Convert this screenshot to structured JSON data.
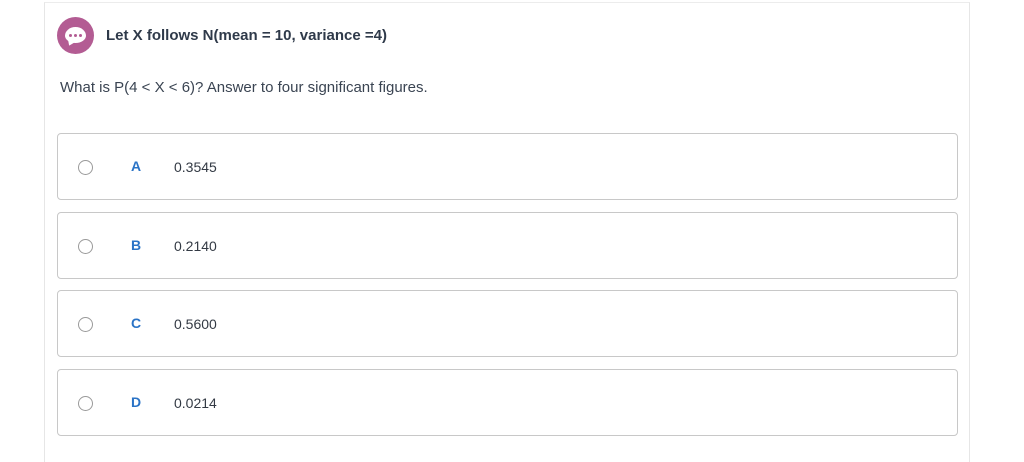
{
  "question": {
    "title": "Let X follows N(mean = 10, variance =4)",
    "prompt": "What is P(4 < X < 6)? Answer to four significant figures.",
    "icon": "chat-bubble-icon",
    "accent_color": "#b35c93"
  },
  "options": [
    {
      "letter": "A",
      "value": "0.3545"
    },
    {
      "letter": "B",
      "value": "0.2140"
    },
    {
      "letter": "C",
      "value": "0.5600"
    },
    {
      "letter": "D",
      "value": "0.0214"
    }
  ],
  "colors": {
    "letter": "#2a73c6",
    "border": "#c8c8c8"
  }
}
